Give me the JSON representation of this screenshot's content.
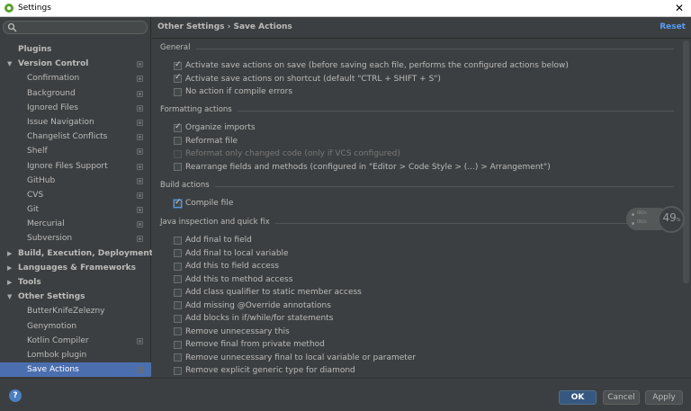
{
  "window": {
    "title": "Settings"
  },
  "search": {
    "placeholder": "",
    "value": ""
  },
  "sidebar": {
    "items": [
      {
        "label": "Plugins",
        "level": 0,
        "arrow": "",
        "project": false,
        "selected": false
      },
      {
        "label": "Version Control",
        "level": 0,
        "arrow": "▼",
        "project": true,
        "selected": false
      },
      {
        "label": "Confirmation",
        "level": 1,
        "arrow": "",
        "project": true,
        "selected": false
      },
      {
        "label": "Background",
        "level": 1,
        "arrow": "",
        "project": true,
        "selected": false
      },
      {
        "label": "Ignored Files",
        "level": 1,
        "arrow": "",
        "project": true,
        "selected": false
      },
      {
        "label": "Issue Navigation",
        "level": 1,
        "arrow": "",
        "project": true,
        "selected": false
      },
      {
        "label": "Changelist Conflicts",
        "level": 1,
        "arrow": "",
        "project": true,
        "selected": false
      },
      {
        "label": "Shelf",
        "level": 1,
        "arrow": "",
        "project": true,
        "selected": false
      },
      {
        "label": "Ignore Files Support",
        "level": 1,
        "arrow": "",
        "project": true,
        "selected": false
      },
      {
        "label": "GitHub",
        "level": 1,
        "arrow": "",
        "project": true,
        "selected": false
      },
      {
        "label": "CVS",
        "level": 1,
        "arrow": "",
        "project": true,
        "selected": false
      },
      {
        "label": "Git",
        "level": 1,
        "arrow": "",
        "project": true,
        "selected": false
      },
      {
        "label": "Mercurial",
        "level": 1,
        "arrow": "",
        "project": true,
        "selected": false
      },
      {
        "label": "Subversion",
        "level": 1,
        "arrow": "",
        "project": true,
        "selected": false
      },
      {
        "label": "Build, Execution, Deployment",
        "level": 0,
        "arrow": "▶",
        "project": false,
        "selected": false
      },
      {
        "label": "Languages & Frameworks",
        "level": 0,
        "arrow": "▶",
        "project": false,
        "selected": false
      },
      {
        "label": "Tools",
        "level": 0,
        "arrow": "▶",
        "project": false,
        "selected": false
      },
      {
        "label": "Other Settings",
        "level": 0,
        "arrow": "▼",
        "project": false,
        "selected": false
      },
      {
        "label": "ButterKnifeZelezny",
        "level": 1,
        "arrow": "",
        "project": false,
        "selected": false
      },
      {
        "label": "Genymotion",
        "level": 1,
        "arrow": "",
        "project": false,
        "selected": false
      },
      {
        "label": "Kotlin Compiler",
        "level": 1,
        "arrow": "",
        "project": true,
        "selected": false
      },
      {
        "label": "Lombok plugin",
        "level": 1,
        "arrow": "",
        "project": false,
        "selected": false
      },
      {
        "label": "Save Actions",
        "level": 1,
        "arrow": "",
        "project": true,
        "selected": true
      }
    ]
  },
  "header": {
    "breadcrumb": "Other Settings › Save Actions",
    "reset_label": "Reset"
  },
  "sections": [
    {
      "title": "General",
      "options": [
        {
          "label": "Activate save actions on save (before saving each file, performs the configured actions below)",
          "checked": true,
          "disabled": false
        },
        {
          "label": "Activate save actions on shortcut (default \"CTRL + SHIFT + S\")",
          "checked": true,
          "disabled": false
        },
        {
          "label": "No action if compile errors",
          "checked": false,
          "disabled": false
        }
      ]
    },
    {
      "title": "Formatting actions",
      "options": [
        {
          "label": "Organize imports",
          "checked": true,
          "disabled": false
        },
        {
          "label": "Reformat file",
          "checked": false,
          "disabled": false
        },
        {
          "label": "Reformat only changed code (only if VCS configured)",
          "checked": false,
          "disabled": true
        },
        {
          "label": "Rearrange fields and methods (configured in \"Editor > Code Style > (...) > Arrangement\")",
          "checked": false,
          "disabled": false
        }
      ]
    },
    {
      "title": "Build actions",
      "options": [
        {
          "label": "Compile file",
          "checked": true,
          "disabled": false,
          "focus": true
        }
      ]
    },
    {
      "title": "Java inspection and quick fix",
      "options": [
        {
          "label": "Add final to field",
          "checked": false,
          "disabled": false
        },
        {
          "label": "Add final to local variable",
          "checked": false,
          "disabled": false
        },
        {
          "label": "Add this to field access",
          "checked": false,
          "disabled": false
        },
        {
          "label": "Add this to method access",
          "checked": false,
          "disabled": false
        },
        {
          "label": "Add class qualifier to static member access",
          "checked": false,
          "disabled": false
        },
        {
          "label": "Add missing @Override annotations",
          "checked": false,
          "disabled": false
        },
        {
          "label": "Add blocks in if/while/for statements",
          "checked": false,
          "disabled": false
        },
        {
          "label": "Remove unnecessary this",
          "checked": false,
          "disabled": false
        },
        {
          "label": "Remove final from private method",
          "checked": false,
          "disabled": false
        },
        {
          "label": "Remove unnecessary final to local variable or parameter",
          "checked": false,
          "disabled": false
        },
        {
          "label": "Remove explicit generic type for diamond",
          "checked": false,
          "disabled": false
        }
      ]
    }
  ],
  "gauge": {
    "up_rate": "0K/s",
    "down_rate": "0K/s",
    "percent": "49",
    "percent_unit": "%"
  },
  "footer": {
    "help": "?",
    "ok": "OK",
    "cancel": "Cancel",
    "apply": "Apply"
  },
  "colors": {
    "background": "#3c3f41",
    "selection": "#4b6eaf",
    "link": "#589df6",
    "ok_button": "#365880"
  }
}
